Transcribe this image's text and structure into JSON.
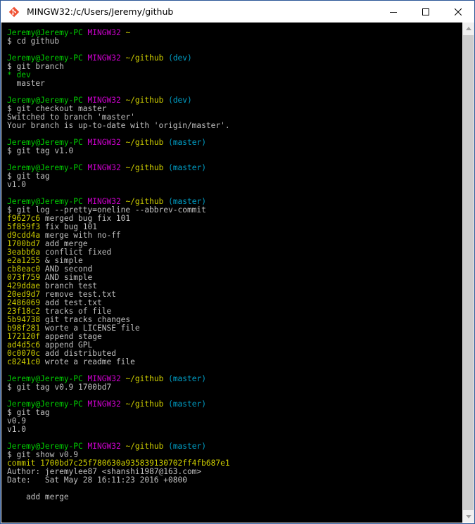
{
  "window": {
    "title": "MINGW32:/c/Users/Jeremy/github",
    "app_icon": "mingw-git-icon",
    "controls": {
      "minimize": "minimize-icon",
      "maximize": "maximize-icon",
      "close": "close-icon"
    }
  },
  "colors": {
    "prompt_user": "#00cd00",
    "prompt_host": "#cd00cd",
    "prompt_path": "#cdcd00",
    "prompt_branch": "#00a0c8",
    "commit_hash": "#cdcd00",
    "branch_current": "#00cd00",
    "text": "#c0c0c0"
  },
  "terminal": {
    "lines": [
      {
        "type": "prompt",
        "user": "Jeremy@Jeremy-PC",
        "host": "MINGW32",
        "path": "~",
        "branch": ""
      },
      {
        "type": "text",
        "text": "$ cd github"
      },
      {
        "type": "blank"
      },
      {
        "type": "prompt",
        "user": "Jeremy@Jeremy-PC",
        "host": "MINGW32",
        "path": "~/github",
        "branch": "(dev)"
      },
      {
        "type": "text",
        "text": "$ git branch"
      },
      {
        "type": "branch-current",
        "text": "* dev"
      },
      {
        "type": "text",
        "text": "  master"
      },
      {
        "type": "blank"
      },
      {
        "type": "prompt",
        "user": "Jeremy@Jeremy-PC",
        "host": "MINGW32",
        "path": "~/github",
        "branch": "(dev)"
      },
      {
        "type": "text",
        "text": "$ git checkout master"
      },
      {
        "type": "text",
        "text": "Switched to branch 'master'"
      },
      {
        "type": "text",
        "text": "Your branch is up-to-date with 'origin/master'."
      },
      {
        "type": "blank"
      },
      {
        "type": "prompt",
        "user": "Jeremy@Jeremy-PC",
        "host": "MINGW32",
        "path": "~/github",
        "branch": "(master)"
      },
      {
        "type": "text",
        "text": "$ git tag v1.0"
      },
      {
        "type": "blank"
      },
      {
        "type": "prompt",
        "user": "Jeremy@Jeremy-PC",
        "host": "MINGW32",
        "path": "~/github",
        "branch": "(master)"
      },
      {
        "type": "text",
        "text": "$ git tag"
      },
      {
        "type": "text",
        "text": "v1.0"
      },
      {
        "type": "blank"
      },
      {
        "type": "prompt",
        "user": "Jeremy@Jeremy-PC",
        "host": "MINGW32",
        "path": "~/github",
        "branch": "(master)"
      },
      {
        "type": "text",
        "text": "$ git log --pretty=oneline --abbrev-commit"
      },
      {
        "type": "commit",
        "hash": "f9627c6",
        "message": " merged bug fix 101"
      },
      {
        "type": "commit",
        "hash": "5f859f3",
        "message": " fix bug 101"
      },
      {
        "type": "commit",
        "hash": "d9cdd4a",
        "message": " merge with no-ff"
      },
      {
        "type": "commit",
        "hash": "1700bd7",
        "message": " add merge"
      },
      {
        "type": "commit",
        "hash": "3eabb6a",
        "message": " conflict fixed"
      },
      {
        "type": "commit",
        "hash": "e2a1255",
        "message": " & simple"
      },
      {
        "type": "commit",
        "hash": "cb8eac0",
        "message": " AND second"
      },
      {
        "type": "commit",
        "hash": "073f759",
        "message": " AND simple"
      },
      {
        "type": "commit",
        "hash": "429ddae",
        "message": " branch test"
      },
      {
        "type": "commit",
        "hash": "20ed9d7",
        "message": " remove test.txt"
      },
      {
        "type": "commit",
        "hash": "2486069",
        "message": " add test.txt"
      },
      {
        "type": "commit",
        "hash": "23f18c2",
        "message": " tracks of file"
      },
      {
        "type": "commit",
        "hash": "5b94738",
        "message": " git tracks changes"
      },
      {
        "type": "commit",
        "hash": "b98f281",
        "message": " worte a LICENSE file"
      },
      {
        "type": "commit",
        "hash": "172120f",
        "message": " append stage"
      },
      {
        "type": "commit",
        "hash": "ad4d5c6",
        "message": " append GPL"
      },
      {
        "type": "commit",
        "hash": "0c0070c",
        "message": " add distributed"
      },
      {
        "type": "commit",
        "hash": "c8241c0",
        "message": " wrote a readme file"
      },
      {
        "type": "blank"
      },
      {
        "type": "prompt",
        "user": "Jeremy@Jeremy-PC",
        "host": "MINGW32",
        "path": "~/github",
        "branch": "(master)"
      },
      {
        "type": "text",
        "text": "$ git tag v0.9 1700bd7"
      },
      {
        "type": "blank"
      },
      {
        "type": "prompt",
        "user": "Jeremy@Jeremy-PC",
        "host": "MINGW32",
        "path": "~/github",
        "branch": "(master)"
      },
      {
        "type": "text",
        "text": "$ git tag"
      },
      {
        "type": "text",
        "text": "v0.9"
      },
      {
        "type": "text",
        "text": "v1.0"
      },
      {
        "type": "blank"
      },
      {
        "type": "prompt",
        "user": "Jeremy@Jeremy-PC",
        "host": "MINGW32",
        "path": "~/github",
        "branch": "(master)"
      },
      {
        "type": "text",
        "text": "$ git show v0.9"
      },
      {
        "type": "commit-full",
        "text": "commit 1700bd7c25f780630a935839130702ff4fb687e1"
      },
      {
        "type": "text",
        "text": "Author: jeremylee87 <shanshi1987@163.com>"
      },
      {
        "type": "text",
        "text": "Date:   Sat May 28 16:11:23 2016 +0800"
      },
      {
        "type": "blank"
      },
      {
        "type": "text",
        "text": "    add merge"
      }
    ]
  },
  "scrollbar": {
    "up_icon": "scroll-up-arrow-icon",
    "down_icon": "scroll-down-arrow-icon"
  }
}
